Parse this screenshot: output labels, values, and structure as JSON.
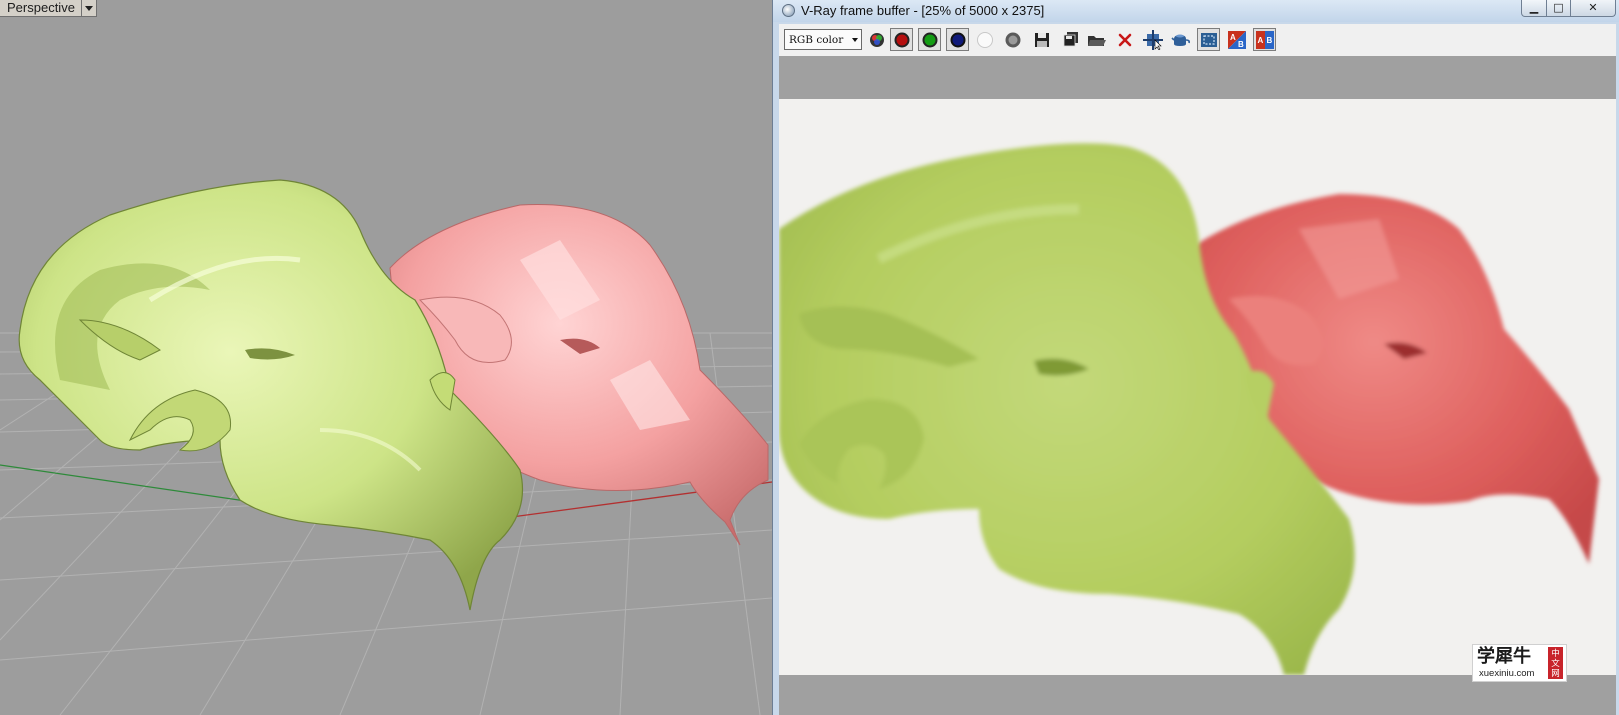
{
  "viewport": {
    "label": "Perspective",
    "menu_icon": "chevron-down-icon"
  },
  "frame_buffer": {
    "title": "V-Ray frame buffer - [25% of 5000 x 2375]",
    "app_icon": "vray-icon",
    "window_controls": {
      "minimize": "▁",
      "maximize": "□",
      "close": "✕"
    },
    "channel_select": {
      "value": "RGB color"
    },
    "toolbar_icons": [
      "display-channels-icon",
      "red-channel-icon",
      "green-channel-icon",
      "blue-channel-icon",
      "alpha-channel-icon",
      "monochrome-icon",
      "save-image-icon",
      "save-all-icon",
      "load-image-icon",
      "clear-image-icon",
      "track-mouse-icon",
      "render-last-icon",
      "region-render-icon",
      "compare-ab-icon",
      "compare-ab-horizontal-icon"
    ],
    "colors": {
      "green_ram": "#b5cf5d",
      "red_ram": "#e05e5e",
      "viewport_green": "#cfe388",
      "viewport_red": "#f3a0a0"
    }
  },
  "watermark": {
    "chinese": "学犀牛",
    "url": "xuexiniu.com",
    "tag": [
      "中",
      "文",
      "网"
    ]
  }
}
